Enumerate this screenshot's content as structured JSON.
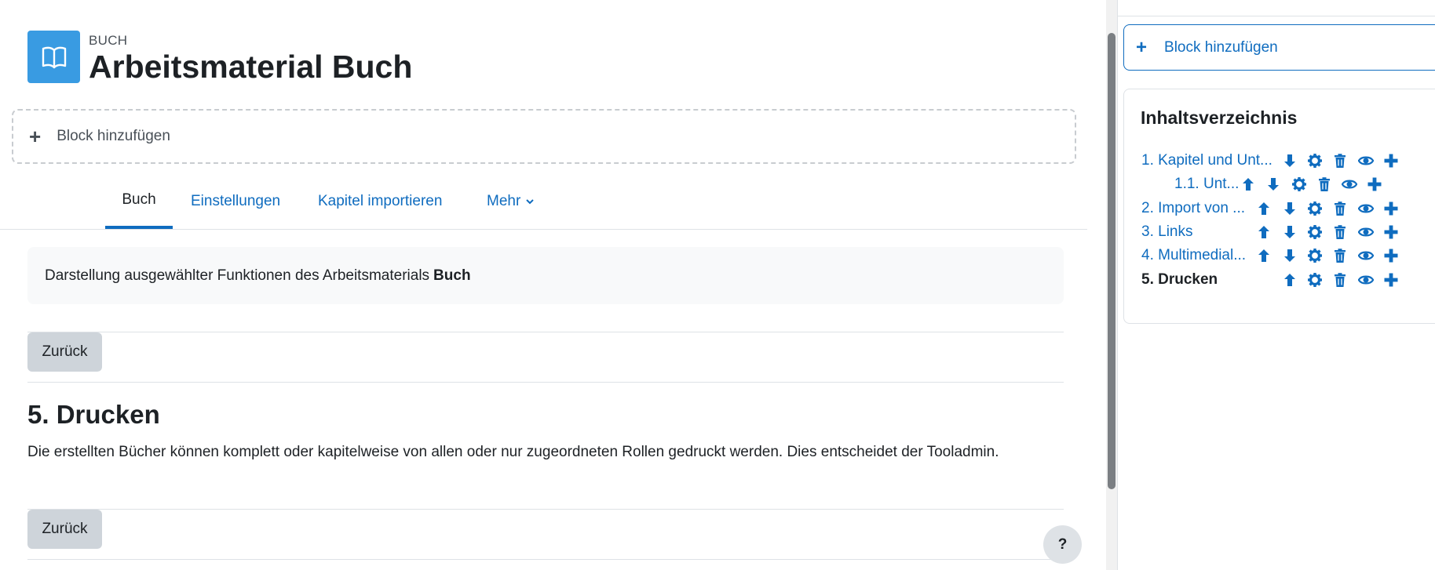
{
  "header": {
    "eyebrow": "BUCH",
    "title": "Arbeitsmaterial Buch"
  },
  "main": {
    "add_block_label": "Block hinzufügen",
    "tabs": [
      {
        "label": "Buch",
        "active": true
      },
      {
        "label": "Einstellungen",
        "active": false
      },
      {
        "label": "Kapitel importieren",
        "active": false
      },
      {
        "label": "Mehr",
        "active": false
      }
    ],
    "intro_text": "Darstellung ausgewählter Funktionen des Arbeitsmaterials",
    "intro_bold": "Buch",
    "back_label_top": "Zurück",
    "chapter_title": "5. Drucken",
    "chapter_text": "Die erstellten Bücher können komplett oder kapitelweise von allen oder nur zugeordneten Rollen gedruckt werden. Dies entscheidet der Tooladmin.",
    "back_label_bottom": "Zurück",
    "help_label": "?"
  },
  "drawer": {
    "add_block_label": "Block hinzufügen",
    "toc_title": "Inhaltsverzeichnis",
    "toc_items": [
      {
        "label": "1. Kapitel und Unt...",
        "current": false,
        "actions": [
          "down",
          "settings",
          "delete",
          "hide",
          "add"
        ]
      },
      {
        "label": "1.1. Unt...",
        "current": false,
        "actions": [
          "up",
          "down",
          "settings",
          "delete",
          "hide",
          "add"
        ]
      },
      {
        "label": "2. Import von ...",
        "current": false,
        "actions": [
          "up",
          "down",
          "settings",
          "delete",
          "hide",
          "add"
        ]
      },
      {
        "label": "3. Links",
        "current": false,
        "actions": [
          "up",
          "down",
          "settings",
          "delete",
          "hide",
          "add"
        ]
      },
      {
        "label": "4. Multimedial...",
        "current": false,
        "actions": [
          "up",
          "down",
          "settings",
          "delete",
          "hide",
          "add"
        ]
      },
      {
        "label": "5. Drucken",
        "current": true,
        "actions": [
          "up",
          "settings",
          "delete",
          "hide",
          "add"
        ]
      }
    ]
  },
  "colors": {
    "accent": "#0f6cbf",
    "book_icon_bg": "#399be2",
    "button_bg": "#ced4da"
  }
}
